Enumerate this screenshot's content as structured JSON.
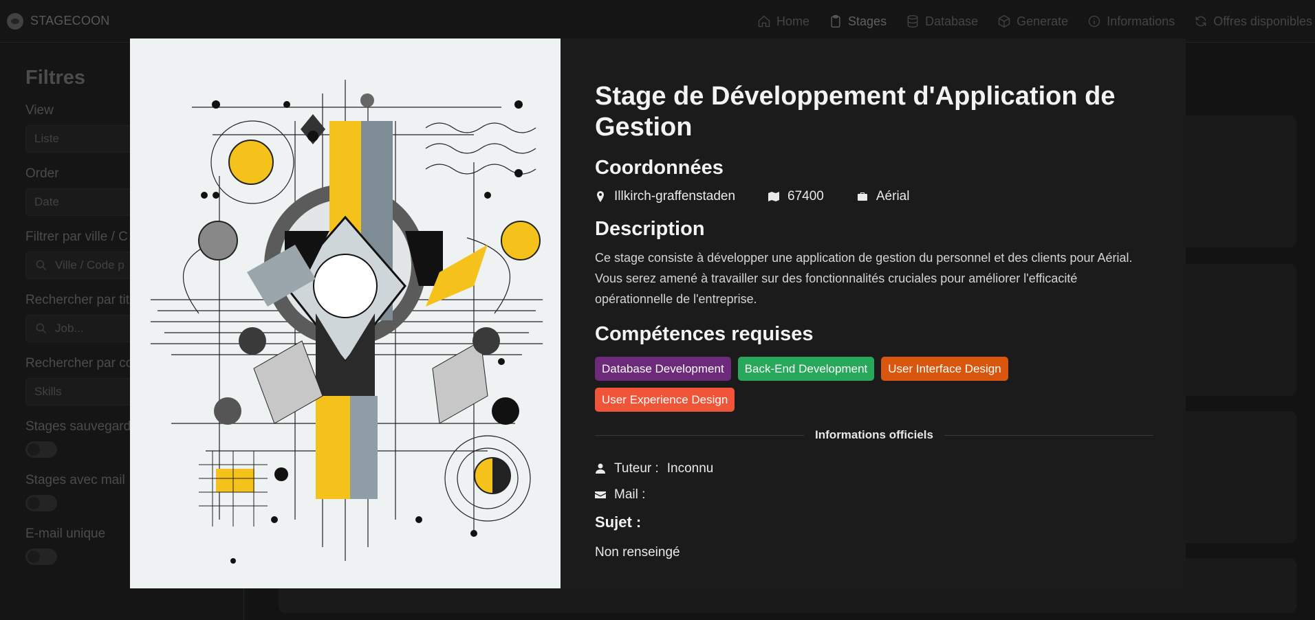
{
  "app": {
    "brand": "STAGECOON"
  },
  "nav": {
    "items": [
      {
        "label": "Home",
        "icon": "home-icon"
      },
      {
        "label": "Stages",
        "icon": "clipboard-icon",
        "active": true
      },
      {
        "label": "Database",
        "icon": "database-icon"
      },
      {
        "label": "Generate",
        "icon": "cube-icon"
      },
      {
        "label": "Informations",
        "icon": "info-icon"
      },
      {
        "label": "Offres disponibles",
        "icon": "refresh-icon"
      }
    ]
  },
  "filters": {
    "title": "Filtres",
    "view": {
      "label": "View",
      "value": "Liste"
    },
    "order": {
      "label": "Order",
      "value": "Date"
    },
    "city": {
      "label": "Filtrer par ville / C",
      "placeholder": "Ville / Code p"
    },
    "title_search": {
      "label": "Rechercher par tit",
      "placeholder": "Job..."
    },
    "skills": {
      "label": "Rechercher par co",
      "value": "Skills"
    },
    "saved": {
      "label": "Stages sauvegard"
    },
    "with_mail": {
      "label": "Stages avec mail"
    },
    "unique_mail": {
      "label": "E-mail unique"
    }
  },
  "modal": {
    "title": "Stage de Développement d'Application de Gestion",
    "coords_heading": "Coordonnées",
    "city": "Illkirch-graffenstaden",
    "postal_code": "67400",
    "company": "Aérial",
    "description_heading": "Description",
    "description": "Ce stage consiste à développer une application de gestion du personnel et des clients pour Aérial. Vous serez amené à travailler sur des fonctionnalités cruciales pour améliorer l'efficacité opérationnelle de l'entreprise.",
    "skills_heading": "Compétences requises",
    "skills": [
      {
        "label": "Database Development",
        "color": "#6d2a7a"
      },
      {
        "label": "Back-End Development",
        "color": "#27a85a"
      },
      {
        "label": "User Interface Design",
        "color": "#d9560f"
      },
      {
        "label": "User Experience Design",
        "color": "#f0553a"
      }
    ],
    "official_heading": "Informations officiels",
    "tutor_label": "Tuteur :",
    "tutor_value": "Inconnu",
    "mail_label": "Mail :",
    "subject_label": "Sujet :",
    "subject_value": "Non renseingé"
  },
  "colors": {
    "accent": "#f5c21b",
    "modal_bg": "#1b1b1b",
    "page_bg": "#1f1f1f"
  }
}
